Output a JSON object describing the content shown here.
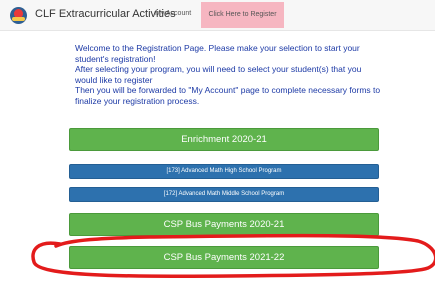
{
  "header": {
    "site_title": "CLF Extracurricular Activities",
    "nav_my_account": "My Account",
    "nav_register": "Click Here to Register"
  },
  "intro": {
    "line1": "Welcome to the Registration Page. Please make your selection to start your student's registration!",
    "line2": "After selecting your program, you will need to select your student(s) that you would like to register",
    "line3": "Then you will be forwarded to \"My Account\" page to complete necessary forms to finalize your registration process."
  },
  "programs": [
    {
      "label": "Enrichment 2020-21"
    },
    {
      "label": "[173] Advanced Math High School Program"
    },
    {
      "label": "[172] Advanced Math Middle School Program"
    },
    {
      "label": "CSP Bus Payments 2020-21"
    },
    {
      "label": "CSP Bus Payments 2021-22"
    }
  ],
  "colors": {
    "green_button": "#5fb34d",
    "blue_button": "#2d71ae",
    "register_tab": "#f6b6c1",
    "intro_text": "#1d3aa6",
    "annotation": "#e31b1b"
  }
}
